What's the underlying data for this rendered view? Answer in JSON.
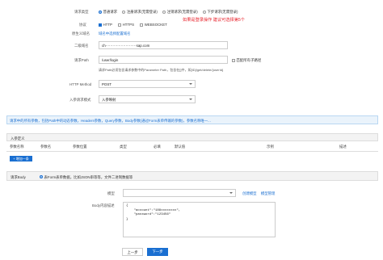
{
  "request_type": {
    "label": "请求类型",
    "options": [
      "普通请求",
      "注册请求(无需登录)",
      "注销请求(无需登录)",
      "下步请求(无需登录)"
    ],
    "selected_index": 0,
    "note": "如果是登录操作 建议可选择第5个"
  },
  "protocol": {
    "label": "协议",
    "options": [
      "HTTP",
      "HTTPS",
      "WEBSOCKET"
    ],
    "checked_index": 0
  },
  "domain": {
    "label": "二级域名",
    "value": "ch··························sap.com",
    "hint_label": "原生义域名",
    "hint_link": "域名中选择配置域名"
  },
  "path": {
    "label": "请求Path",
    "value": "/user/login",
    "match_label": "匹配所有子路径",
    "hint": "请求Path必须包含请求参数中的Parameter Path，包含在[]中，如[ID]/get/delete/{userId}"
  },
  "http_method": {
    "label": "HTTP Method",
    "value": "POST"
  },
  "param_mode": {
    "label": "入参请求模式",
    "value": "入参映射"
  },
  "banner": "请求中的所有参数，包括Path中的动态参数，Headers参数，Query参数，Body参数(通过Form表单传输的参数)，参数名称唯一...",
  "params": {
    "title": "入参定义",
    "headers": [
      "参数名称",
      "参数名",
      "参数位置",
      "类型",
      "必填",
      "默认值",
      "示例",
      "描述"
    ],
    "add_button": "+ 增加一条"
  },
  "body": {
    "label": "请求Body",
    "option": "表Form表单数据，比如JSON串等等，文件二进制数据等",
    "model_label": "模型",
    "model_links": [
      "创建模型",
      "模型管理"
    ],
    "desc_label": "Body内容描述",
    "content": [
      "{",
      "    \"account\":\"188xxxxxxxx\",",
      "    \"password\":\"123456\"",
      "}"
    ]
  },
  "footer": {
    "prev": "上一步",
    "next": "下一步"
  },
  "colors": {
    "accent": "#1a6fd1",
    "warning": "#e8222b",
    "banner_bg": "#eaf3fb"
  }
}
